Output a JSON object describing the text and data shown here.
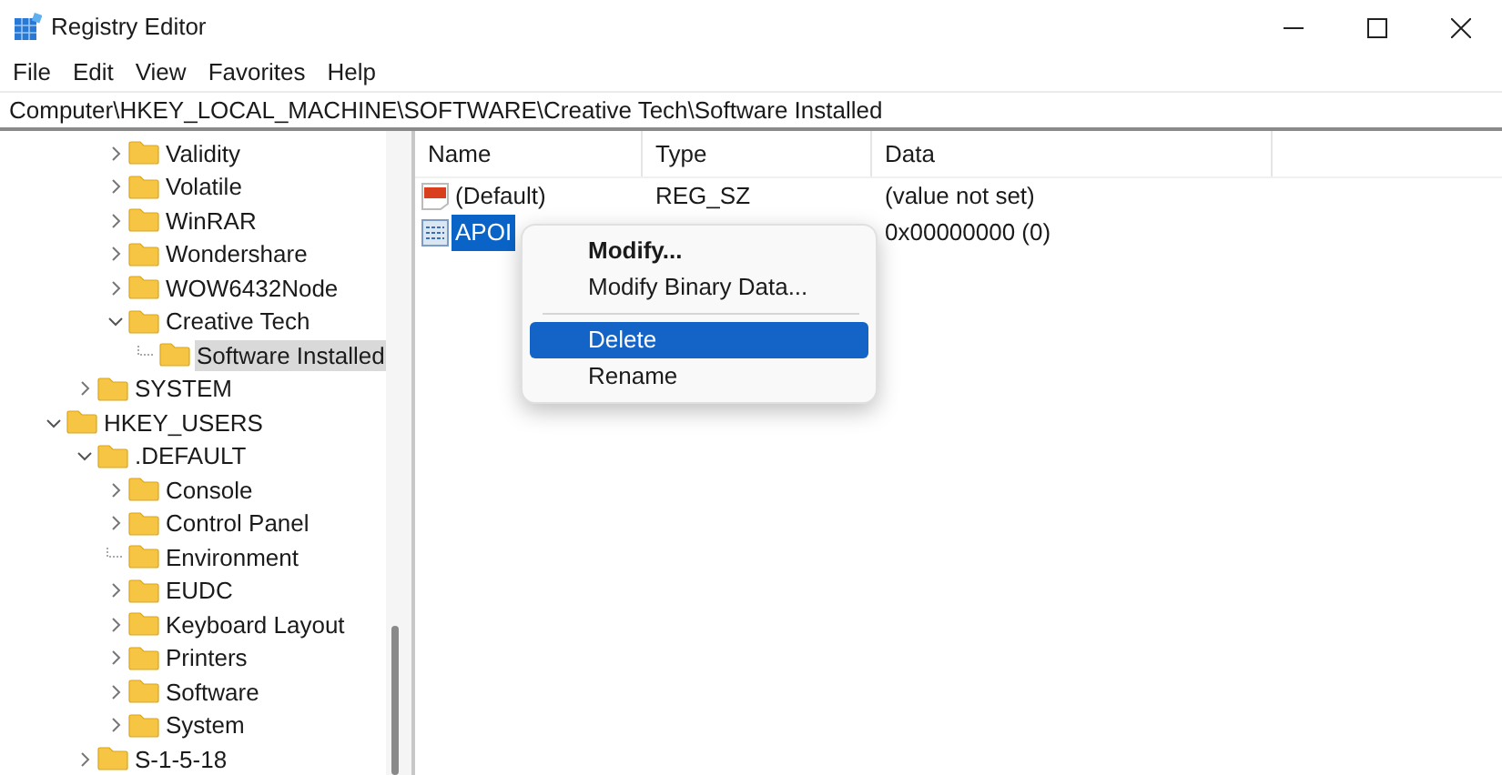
{
  "window": {
    "title": "Registry Editor"
  },
  "menu": [
    "File",
    "Edit",
    "View",
    "Favorites",
    "Help"
  ],
  "address": "Computer\\HKEY_LOCAL_MACHINE\\SOFTWARE\\Creative Tech\\Software Installed",
  "tree": {
    "software_children": [
      {
        "label": "Validity",
        "kind": "closed",
        "selected": false
      },
      {
        "label": "Volatile",
        "kind": "closed",
        "selected": false
      },
      {
        "label": "WinRAR",
        "kind": "closed",
        "selected": false
      },
      {
        "label": "Wondershare",
        "kind": "closed",
        "selected": false
      },
      {
        "label": "WOW6432Node",
        "kind": "closed",
        "selected": false
      },
      {
        "label": "Creative Tech",
        "kind": "open",
        "selected": false,
        "children": [
          {
            "label": "Software Installed",
            "kind": "leaf",
            "selected": true
          }
        ]
      }
    ],
    "machine_children": [
      {
        "label": "SYSTEM",
        "kind": "closed",
        "selected": false
      }
    ],
    "roots": [
      {
        "label": "HKEY_USERS",
        "kind": "open",
        "selected": false,
        "children": [
          {
            "label": ".DEFAULT",
            "kind": "open",
            "selected": false,
            "children": [
              {
                "label": "Console",
                "kind": "closed",
                "selected": false
              },
              {
                "label": "Control Panel",
                "kind": "closed",
                "selected": false
              },
              {
                "label": "Environment",
                "kind": "leaf",
                "selected": false
              },
              {
                "label": "EUDC",
                "kind": "closed",
                "selected": false
              },
              {
                "label": "Keyboard Layout",
                "kind": "closed",
                "selected": false
              },
              {
                "label": "Printers",
                "kind": "closed",
                "selected": false
              },
              {
                "label": "Software",
                "kind": "closed",
                "selected": false
              },
              {
                "label": "System",
                "kind": "closed",
                "selected": false
              }
            ]
          },
          {
            "label": "S-1-5-18",
            "kind": "closed",
            "selected": false
          }
        ]
      }
    ]
  },
  "values": {
    "columns": [
      "Name",
      "Type",
      "Data"
    ],
    "rows": [
      {
        "kind": "string",
        "name": "(Default)",
        "type": "REG_SZ",
        "data": "(value not set)",
        "selected": false
      },
      {
        "kind": "binary",
        "name": "APOI",
        "data": "0x00000000 (0)",
        "selected": true
      }
    ]
  },
  "context_menu": [
    {
      "kind": "item",
      "label": "Modify...",
      "bold": true,
      "selected": false
    },
    {
      "kind": "item",
      "label": "Modify Binary Data...",
      "bold": false,
      "selected": false
    },
    {
      "kind": "separator"
    },
    {
      "kind": "item",
      "label": "Delete",
      "bold": false,
      "selected": true
    },
    {
      "kind": "item",
      "label": "Rename",
      "bold": false,
      "selected": false
    }
  ]
}
